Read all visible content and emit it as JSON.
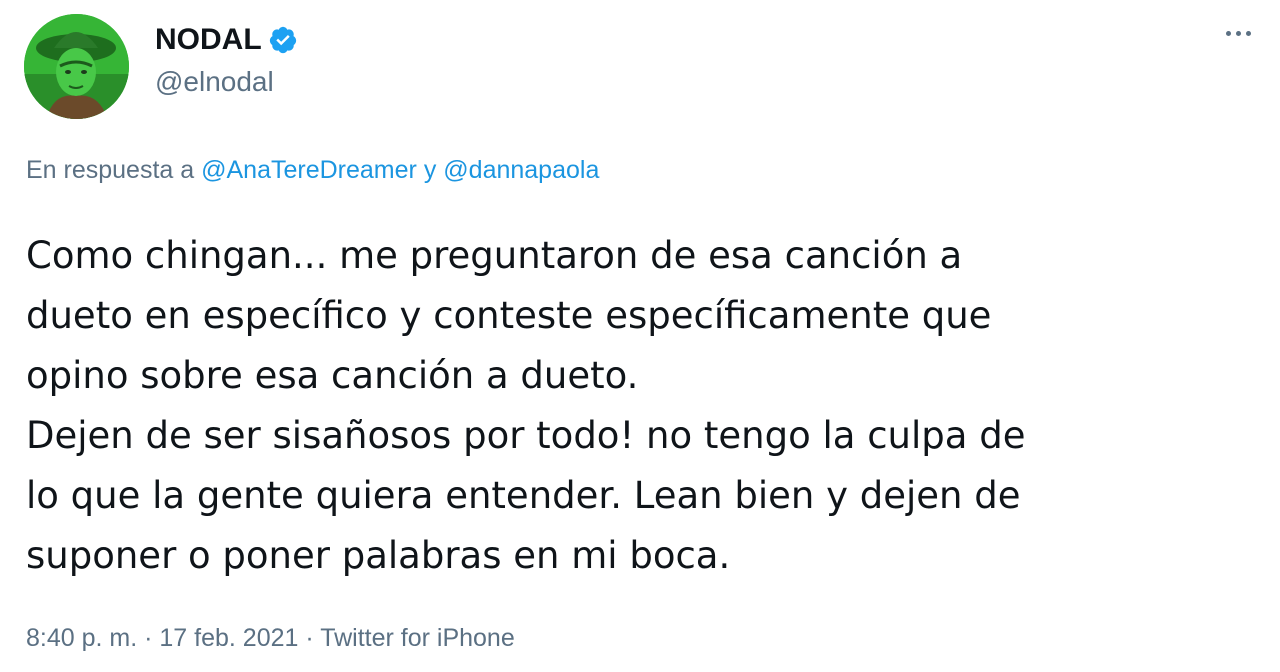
{
  "author": {
    "display_name": "NODAL",
    "handle": "@elnodal",
    "verified": true,
    "avatar_icon": "profile-photo",
    "verified_color": "#1da1f2"
  },
  "menu": {
    "icon": "more-horizontal-icon"
  },
  "reply": {
    "prefix": "En respuesta a",
    "mention_1": "@AnaTereDreamer",
    "connector": "y",
    "mention_2": "@dannapaola"
  },
  "tweet": {
    "text": "Como chingan... me preguntaron de esa canción a\ndueto en específico y conteste específicamente que\nopino sobre esa canción a dueto.\nDejen de ser sisañosos por todo! no tengo la culpa de\nlo que la gente quiera entender. Lean bien y dejen de\nsuponer o poner palabras en mi boca."
  },
  "meta": {
    "time": "8:40 p. m.",
    "separator": "·",
    "date": "17 feb. 2021",
    "source": "Twitter for iPhone"
  },
  "colors": {
    "accent": "#1b95e0",
    "secondary_text": "#5b7083",
    "primary_text": "#0f1419"
  }
}
